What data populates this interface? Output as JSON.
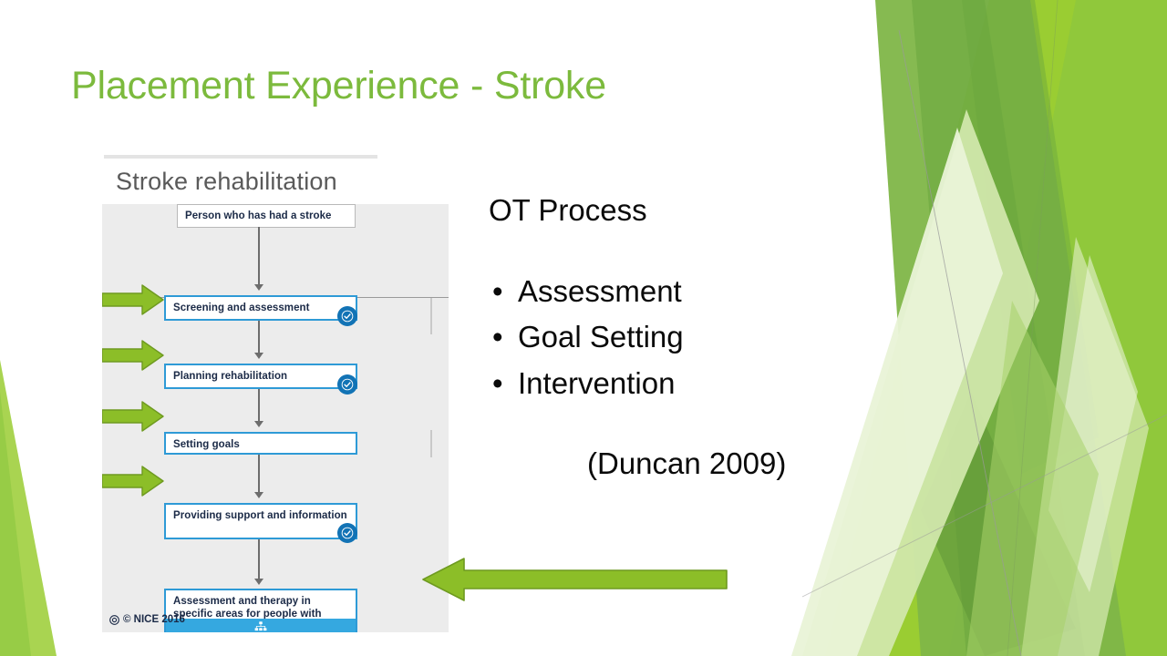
{
  "slide": {
    "title": "Placement Experience - Stroke",
    "title_color": "#7CBA3D"
  },
  "body": {
    "heading": "OT Process",
    "bullet_char": "•",
    "bullets": [
      "Assessment",
      "Goal Setting",
      "Intervention"
    ],
    "citation": "(Duncan 2009)"
  },
  "flowchart": {
    "title": "Stroke rehabilitation",
    "credit": "© NICE 2016",
    "accent_color": "#2e9ad6",
    "badge_color": "#1273b5",
    "panel_color": "#ececec",
    "nodes": [
      {
        "label": "Person who has had a stroke",
        "badge": false
      },
      {
        "label": "Screening and assessment",
        "badge": true
      },
      {
        "label": "Planning rehabilitation",
        "badge": true
      },
      {
        "label": "Setting goals",
        "badge": false
      },
      {
        "label": "Providing support and information",
        "badge": true
      },
      {
        "label": "Assessment and therapy in specific areas for people with stroke",
        "badge": false
      }
    ]
  },
  "callouts": {
    "arrow_fill": "#8CBE28",
    "arrow_stroke": "#6E9A20",
    "small_arrow_count": 4,
    "big_arrow_direction": "left"
  },
  "background": {
    "theme": "facet",
    "colors": {
      "light_1": "#E9F3D7",
      "light_2": "#D3E8AE",
      "mid_1": "#A8D16A",
      "mid_2": "#7FB648",
      "dark_1": "#6AA63E",
      "bright_1": "#9ACD32",
      "bright_2": "#8CC63F"
    }
  }
}
